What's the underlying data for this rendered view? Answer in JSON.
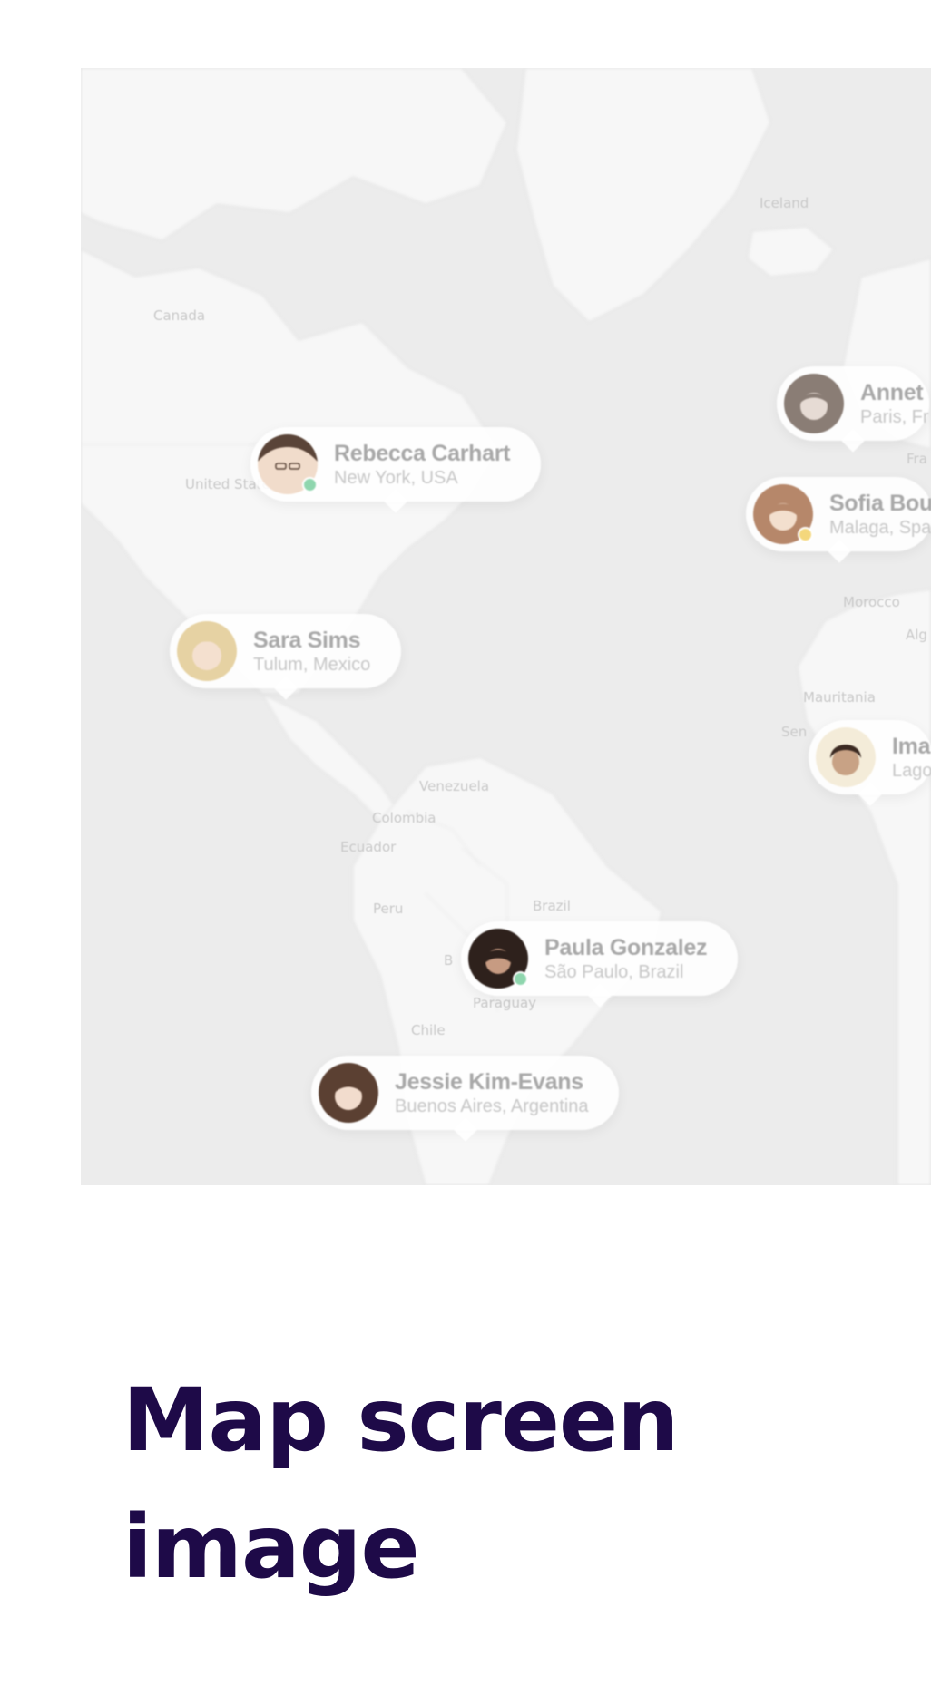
{
  "map": {
    "country_labels": [
      {
        "id": "iceland",
        "text": "Iceland"
      },
      {
        "id": "canada",
        "text": "Canada"
      },
      {
        "id": "france",
        "text": "Fra"
      },
      {
        "id": "united-states",
        "text": "United States"
      },
      {
        "id": "morocco",
        "text": "Morocco"
      },
      {
        "id": "algeria",
        "text": "Alg"
      },
      {
        "id": "mauritania",
        "text": "Mauritania"
      },
      {
        "id": "senegal",
        "text": "Sen"
      },
      {
        "id": "venezuela",
        "text": "Venezuela"
      },
      {
        "id": "colombia",
        "text": "Colombia"
      },
      {
        "id": "ecuador",
        "text": "Ecuador"
      },
      {
        "id": "brazil",
        "text": "Brazil"
      },
      {
        "id": "peru",
        "text": "Peru"
      },
      {
        "id": "bolivia",
        "text": "B"
      },
      {
        "id": "paraguay",
        "text": "Paraguay"
      },
      {
        "id": "chile",
        "text": "Chile"
      }
    ],
    "people": [
      {
        "id": "rebecca",
        "name": "Rebecca Carhart",
        "location": "New York, USA",
        "status": "online",
        "status_color": "#8fd6ae",
        "hair_color": "#5a4438",
        "skin_color": "#f1dccb"
      },
      {
        "id": "sara",
        "name": "Sara Sims",
        "location": "Tulum, Mexico",
        "status": "none",
        "status_color": "",
        "hair_color": "#e6d2a3",
        "skin_color": "#f4e0cf"
      },
      {
        "id": "annette",
        "name": "Annet",
        "location": "Paris, Fr",
        "status": "none",
        "status_color": "",
        "hair_color": "#8a7d75",
        "skin_color": "#e6dbd4"
      },
      {
        "id": "sofia",
        "name": "Sofia Bou",
        "location": "Malaga, Spa",
        "status": "away",
        "status_color": "#f4d77c",
        "hair_color": "#b6876a",
        "skin_color": "#f3dfce"
      },
      {
        "id": "ima",
        "name": "Ima",
        "location": "Lago",
        "status": "none",
        "status_color": "",
        "hair_color": "#3c2a22",
        "skin_color": "#c8a285"
      },
      {
        "id": "paula",
        "name": "Paula Gonzalez",
        "location": "São Paulo, Brazil",
        "status": "online",
        "status_color": "#8fd6ae",
        "hair_color": "#2e211c",
        "skin_color": "#c79b82"
      },
      {
        "id": "jessie",
        "name": "Jessie Kim-Evans",
        "location": "Buenos Aires, Argentina",
        "status": "none",
        "status_color": "",
        "hair_color": "#5b4032",
        "skin_color": "#f2dccd"
      }
    ]
  },
  "title": {
    "line1": "Map screen",
    "line2": "image"
  },
  "colors": {
    "title": "#1e0a48",
    "map_water": "#ececec",
    "map_land": "#f7f7f7"
  }
}
